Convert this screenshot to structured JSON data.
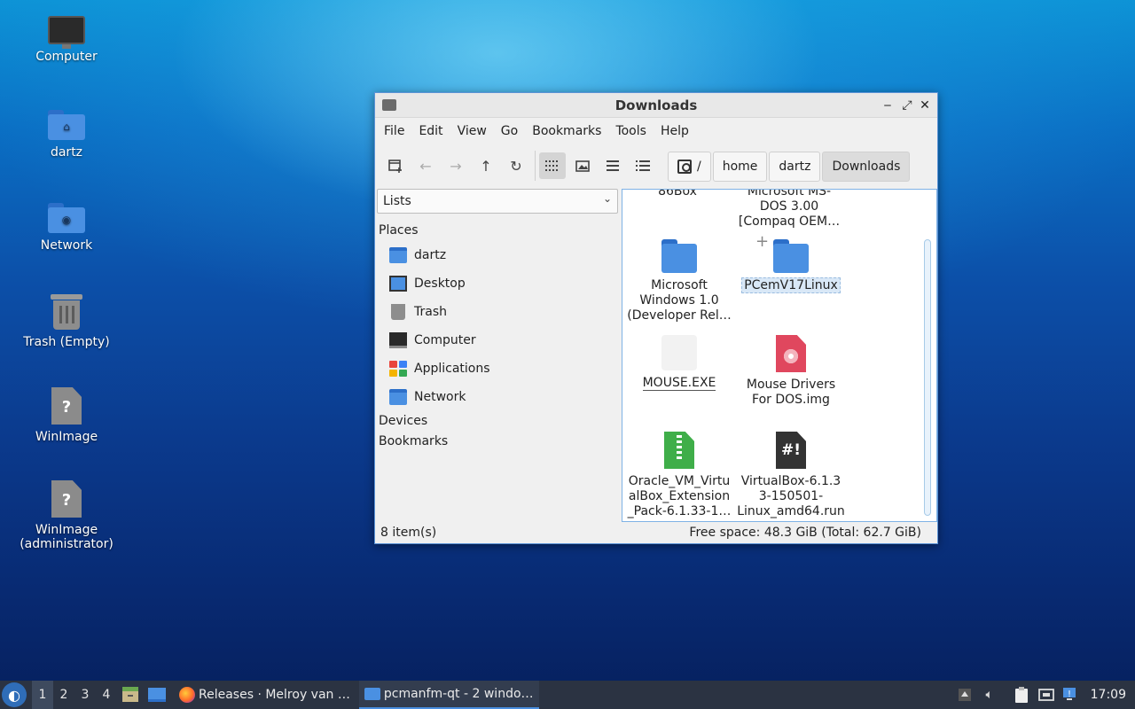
{
  "desktop": {
    "icons": [
      {
        "label": "Computer"
      },
      {
        "label": "dartz"
      },
      {
        "label": "Network"
      },
      {
        "label": "Trash (Empty)"
      },
      {
        "label": "WinImage"
      },
      {
        "label": "WinImage (administrator)"
      }
    ]
  },
  "window": {
    "title": "Downloads",
    "controls": {
      "minimize": "‒",
      "maximize": "⤢",
      "close": "✕"
    },
    "menus": [
      "File",
      "Edit",
      "View",
      "Go",
      "Bookmarks",
      "Tools",
      "Help"
    ],
    "path": [
      "/",
      "home",
      "dartz",
      "Downloads"
    ],
    "sidebar": {
      "selector": "Lists",
      "places_heading": "Places",
      "places": [
        "dartz",
        "Desktop",
        "Trash",
        "Computer",
        "Applications",
        "Network"
      ],
      "devices_heading": "Devices",
      "bookmarks_heading": "Bookmarks"
    },
    "files": {
      "partial_top_left": "86Box",
      "partial_top_right_line1": "Microsoft MS-",
      "partial_top_right_line2": "DOS 3.00",
      "partial_top_right_line3": "[Compaq OEM…",
      "item1_line1": "Microsoft",
      "item1_line2": "Windows 1.0",
      "item1_line3": "(Developer Rel…",
      "item2": "PCemV17Linux",
      "item3": "MOUSE.EXE",
      "item4_line1": "Mouse Drivers",
      "item4_line2": "For DOS.img",
      "item5_line1": "Oracle_VM_Virtu",
      "item5_line2": "alBox_Extension",
      "item5_line3": "_Pack-6.1.33-1…",
      "item6_line1": "VirtualBox-6.1.3",
      "item6_line2": "3-150501-",
      "item6_line3": "Linux_amd64.run"
    },
    "status": {
      "items": "8 item(s)",
      "free_space": "Free space: 48.3 GiB (Total: 62.7 GiB)"
    }
  },
  "taskbar": {
    "workspaces": [
      "1",
      "2",
      "3",
      "4"
    ],
    "tasks": [
      {
        "label": "Releases · Melroy van …"
      },
      {
        "label": "pcmanfm-qt - 2 windo…"
      }
    ],
    "clock": "17:09"
  }
}
